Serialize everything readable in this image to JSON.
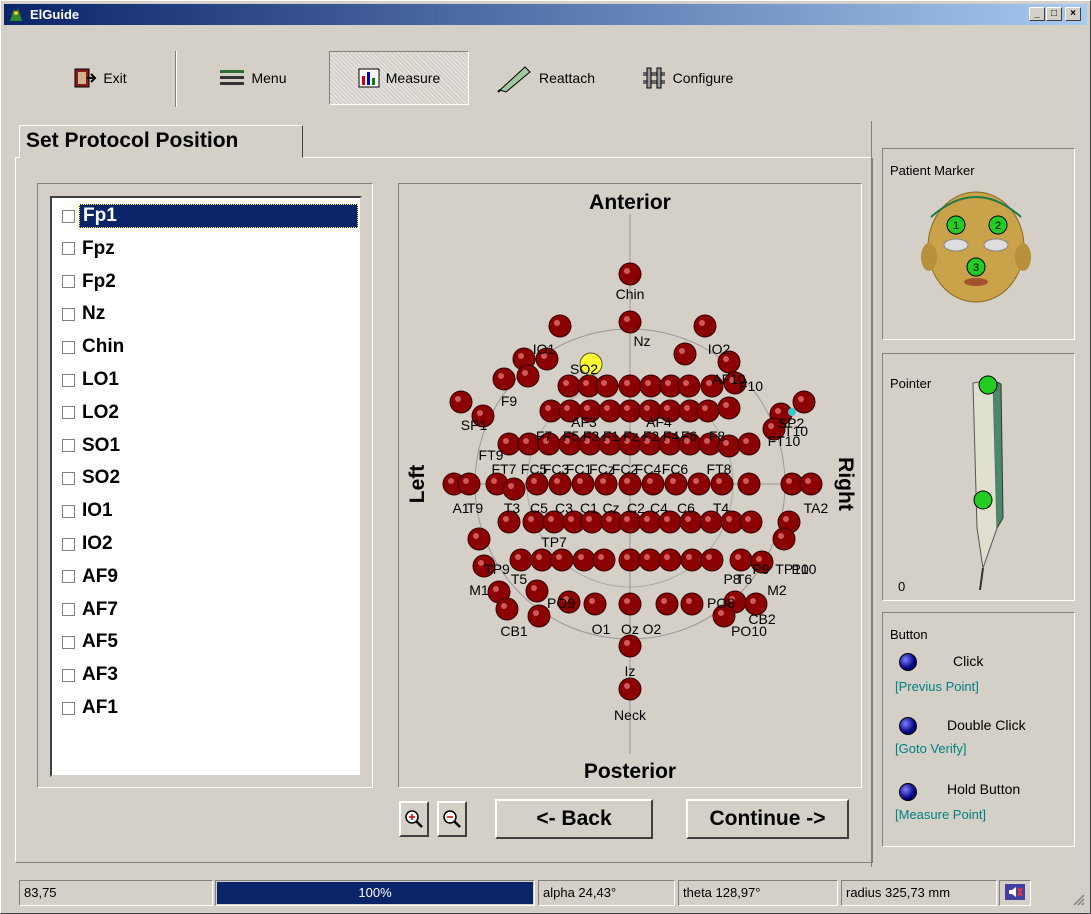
{
  "window": {
    "title": "ElGuide"
  },
  "toolbar": {
    "exit": "Exit",
    "menu": "Menu",
    "measure": "Measure",
    "reattach": "Reattach",
    "configure": "Configure"
  },
  "tab": {
    "label": "Set Protocol Position"
  },
  "list": {
    "items": [
      "Fp1",
      "Fpz",
      "Fp2",
      "Nz",
      "Chin",
      "LO1",
      "LO2",
      "SO1",
      "SO2",
      "IO1",
      "IO2",
      "AF9",
      "AF7",
      "AF5",
      "AF3",
      "AF1"
    ],
    "selected_index": 0
  },
  "headmap": {
    "anterior": "Anterior",
    "posterior": "Posterior",
    "left": "Left",
    "right": "Right",
    "labels": [
      "Chin",
      "Nz",
      "IO1",
      "IO2",
      "SO2",
      "AF10",
      "F9",
      "F10",
      "SP2",
      "SP1",
      "F7",
      "F5",
      "F3",
      "F1",
      "Fz",
      "F2",
      "F4",
      "F6",
      "F8",
      "FT10",
      "FT9",
      "FT7",
      "FC5",
      "FC3",
      "FC1",
      "FCz",
      "FC2",
      "FC4",
      "FC6",
      "FT8",
      "A1",
      "T9",
      "T3",
      "C5",
      "C3",
      "C1",
      "Cz",
      "C2",
      "C4",
      "C6",
      "T4",
      "TA2",
      "TP10",
      "TP9",
      "P9",
      "P10",
      "M1",
      "M2",
      "T5",
      "T6",
      "PO9",
      "PO10",
      "CB1",
      "CB2",
      "O1",
      "O2",
      "Oz",
      "Iz",
      "Neck",
      "AF3",
      "AF4",
      "T10",
      "TP7",
      "P8",
      "PO8"
    ]
  },
  "buttons": {
    "back": "<- Back",
    "continue": "Continue ->"
  },
  "patient_marker": {
    "title": "Patient Marker",
    "markers": [
      "1",
      "2",
      "3"
    ]
  },
  "pointer": {
    "title": "Pointer",
    "zero": "0"
  },
  "button_group": {
    "title": "Button",
    "click": "Click",
    "click_hint": "[Previus Point]",
    "double_click": "Double Click",
    "double_click_hint": "[Goto Verify]",
    "hold": "Hold Button",
    "hold_hint": "[Measure Point]"
  },
  "status": {
    "coord": "83,75",
    "progress_text": "100%",
    "progress": 1.0,
    "alpha": "alpha 24,43°",
    "theta": "theta 128,97°",
    "radius": "radius 325,73 mm"
  },
  "colors": {
    "electrode": "#8b0000",
    "selected": "#ffff33",
    "progress": "#0a246a",
    "marker": "#22cc22"
  }
}
